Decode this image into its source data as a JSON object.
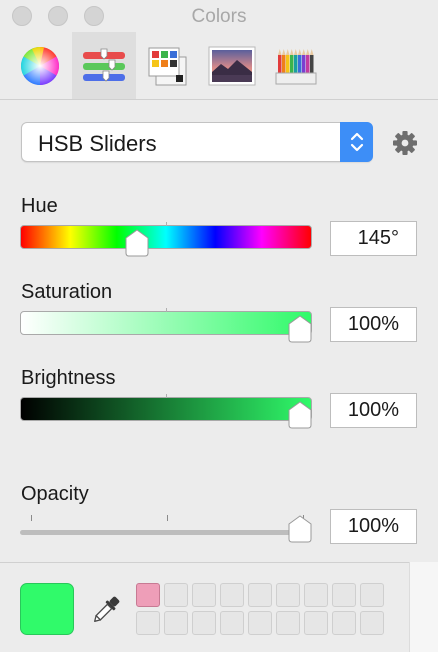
{
  "window": {
    "title": "Colors",
    "buttons": [
      "close",
      "minimize",
      "zoom"
    ]
  },
  "toolbar": {
    "tabs": [
      {
        "name": "color-wheel",
        "icon": "color-wheel-icon",
        "selected": false
      },
      {
        "name": "color-sliders",
        "icon": "sliders-icon",
        "selected": true
      },
      {
        "name": "color-palettes",
        "icon": "palettes-icon",
        "selected": false
      },
      {
        "name": "image-palettes",
        "icon": "image-palette-icon",
        "selected": false
      },
      {
        "name": "pencils",
        "icon": "pencils-icon",
        "selected": false
      }
    ]
  },
  "mode_popup": {
    "selected": "HSB Sliders"
  },
  "sliders": {
    "hue": {
      "label": "Hue",
      "value_text": "145°",
      "fraction": 0.4
    },
    "saturation": {
      "label": "Saturation",
      "value_text": "100%",
      "fraction": 1.0
    },
    "brightness": {
      "label": "Brightness",
      "value_text": "100%",
      "fraction": 1.0
    },
    "opacity": {
      "label": "Opacity",
      "value_text": "100%",
      "fraction": 1.0
    }
  },
  "current_color": "#30fa6a",
  "swatches": {
    "filled": [
      "#ee9eb8"
    ],
    "empty_color": "#e6e6e6"
  }
}
